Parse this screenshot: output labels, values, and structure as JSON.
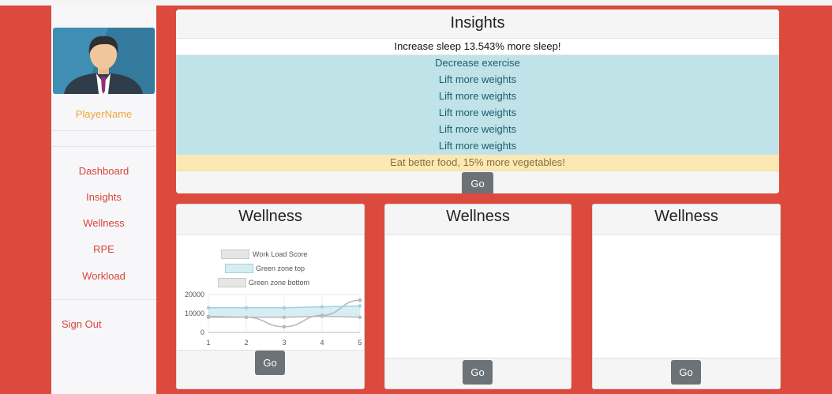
{
  "sidebar": {
    "player_name": "PlayerName",
    "nav": [
      "Dashboard",
      "Insights",
      "Wellness",
      "RPE",
      "Workload"
    ],
    "sign_out": "Sign Out"
  },
  "insights": {
    "title": "Insights",
    "rows": [
      {
        "text": "Increase sleep 13.543% more sleep!",
        "style": "white"
      },
      {
        "text": "Decrease exercise",
        "style": "info"
      },
      {
        "text": "Lift more weights",
        "style": "info"
      },
      {
        "text": "Lift more weights",
        "style": "info"
      },
      {
        "text": "Lift more weights",
        "style": "info"
      },
      {
        "text": "Lift more weights",
        "style": "info"
      },
      {
        "text": "Lift more weights",
        "style": "info"
      },
      {
        "text": "Eat better food, 15% more vegetables!",
        "style": "warn"
      }
    ],
    "go_label": "Go"
  },
  "cards": [
    {
      "title": "Wellness",
      "go_label": "Go"
    },
    {
      "title": "Wellness",
      "go_label": "Go"
    },
    {
      "title": "Wellness",
      "go_label": "Go"
    }
  ],
  "colors": {
    "accent_red": "#dc4a3d",
    "nav_text": "#d9433a",
    "player_name": "#f0a43a",
    "info_row": "#bfe3e8",
    "warn_row": "#fbe8b4",
    "button": "#6b7278"
  },
  "chart_data": {
    "type": "line",
    "x": [
      1,
      2,
      3,
      4,
      5
    ],
    "series": [
      {
        "name": "Work Load Score",
        "values": [
          8000,
          8000,
          3000,
          9000,
          17000
        ]
      },
      {
        "name": "Green zone top",
        "values": [
          13000,
          13000,
          13000,
          13500,
          14000
        ]
      },
      {
        "name": "Green zone bottom",
        "values": [
          8500,
          8000,
          8000,
          8500,
          8000
        ]
      }
    ],
    "ylim": [
      0,
      20000
    ],
    "yticks": [
      0,
      10000,
      20000
    ],
    "xlabel": "",
    "ylabel": "",
    "legend_position": "top",
    "grid": true
  }
}
